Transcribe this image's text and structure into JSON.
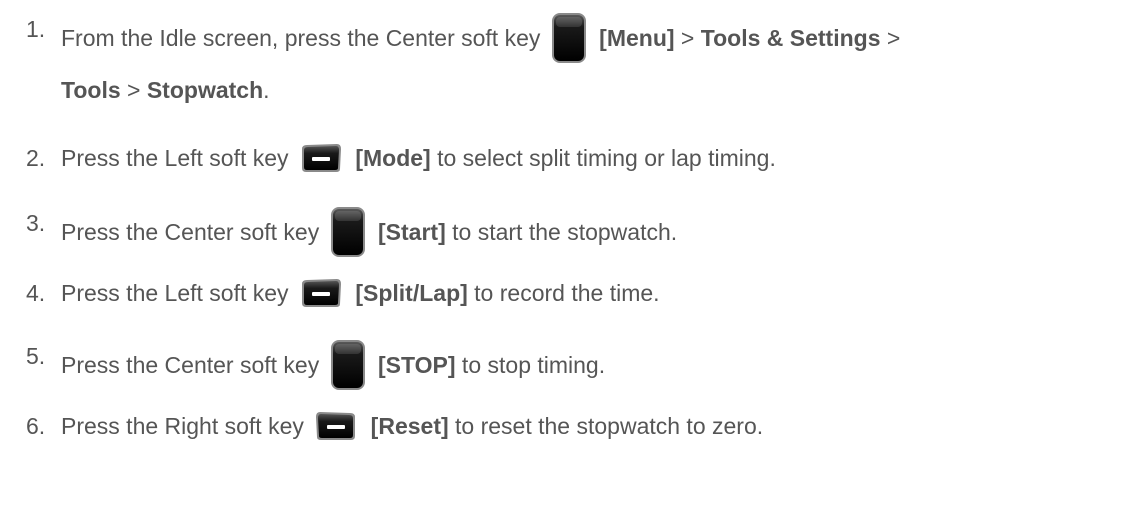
{
  "steps": [
    {
      "number": "1.",
      "before": "From the Idle screen, press the Center soft key",
      "key_icon": "center-soft-key-icon",
      "key_label": "[Menu]",
      "sep1": " > ",
      "path1": "Tools & Settings",
      "sep2": " >",
      "path2": "Tools",
      "sep3": " > ",
      "path3": "Stopwatch",
      "end": "."
    },
    {
      "number": "2.",
      "before": "Press the Left soft key",
      "key_icon": "left-soft-key-icon",
      "key_label": "[Mode]",
      "after": " to select split timing or lap timing."
    },
    {
      "number": "3.",
      "before": "Press the Center soft key",
      "key_icon": "center-soft-key-icon",
      "key_label": "[Start]",
      "after": " to start the stopwatch."
    },
    {
      "number": "4.",
      "before": "Press the Left soft key",
      "key_icon": "left-soft-key-icon",
      "key_label": "[Split/Lap]",
      "after": " to record the time."
    },
    {
      "number": "5.",
      "before": "Press the Center soft key",
      "key_icon": "center-soft-key-icon",
      "key_label": "[STOP]",
      "after": " to stop timing."
    },
    {
      "number": "6.",
      "before": "Press the Right soft key",
      "key_icon": "right-soft-key-icon",
      "key_label": "[Reset]",
      "after": " to reset the stopwatch to zero."
    }
  ],
  "colors": {
    "text": "#555555",
    "key_body": "#111111"
  }
}
